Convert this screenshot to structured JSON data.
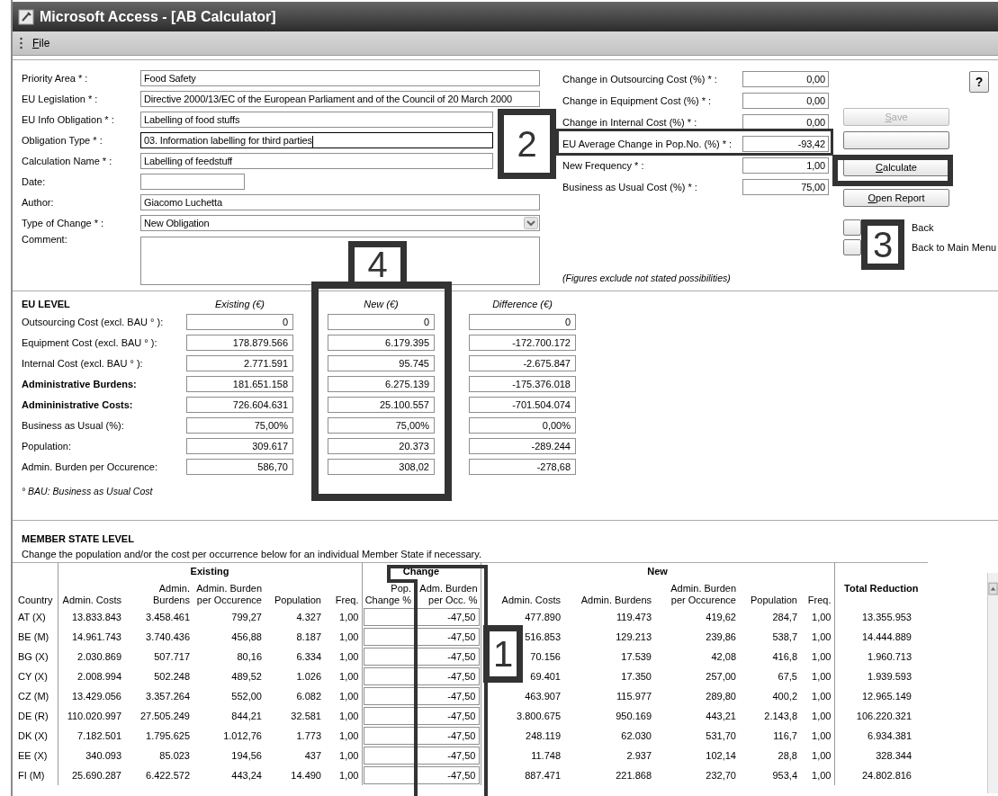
{
  "window": {
    "title": "Microsoft Access - [AB Calculator]"
  },
  "menu": [
    {
      "label": "File"
    }
  ],
  "details": [
    {
      "kind": "text",
      "label": "Priority Area * :",
      "value": "Food Safety",
      "focused": false
    },
    {
      "kind": "text",
      "label": "EU Legislation * :",
      "value": "Directive 2000/13/EC of the European Parliament and of the Council of 20 March 2000",
      "focused": false
    },
    {
      "kind": "text",
      "label": "EU Info Obligation * :",
      "value": "Labelling of food stuffs",
      "focused": false
    },
    {
      "kind": "text",
      "label": "Obligation Type * :",
      "value": "03. Information labelling for third parties",
      "focused": true
    },
    {
      "kind": "text",
      "label": "Calculation Name * :",
      "value": "Labelling of feedstuff",
      "focused": false
    },
    {
      "kind": "date",
      "label": "Date:"
    },
    {
      "kind": "text",
      "label": "Author:",
      "value": "Giacomo Luchetta",
      "focused": false
    },
    {
      "kind": "dropdown",
      "label": "Type of Change * :",
      "value": "New Obligation"
    },
    {
      "kind": "memo",
      "label": "Comment:"
    }
  ],
  "parameters": [
    {
      "label": "Change in Outsourcing Cost (%) * :",
      "value": "0,00"
    },
    {
      "label": "Change in Equipment Cost (%) * :",
      "value": "0,00"
    },
    {
      "label": "Change in Internal Cost (%) * :",
      "value": "0,00"
    },
    {
      "label": "EU Average Change in Pop.No. (%) * :",
      "value": "-93,42"
    },
    {
      "label": "New Frequency * :",
      "value": "1,00"
    },
    {
      "label": "Business as Usual Cost (%) * :",
      "value": "75,00"
    }
  ],
  "help_button": {
    "label": "?"
  },
  "actions": [
    {
      "kind": "button",
      "label": "Save",
      "disabled": true
    },
    {
      "kind": "button",
      "disabled": false
    },
    {
      "kind": "button",
      "label": "Calculate",
      "disabled": false
    },
    {
      "kind": "button",
      "label": "Open Report",
      "disabled": false
    },
    {
      "kind": "square",
      "label": "Back"
    },
    {
      "kind": "square",
      "label": "Back to Main Menu"
    }
  ],
  "note": "(Figures exclude not stated possibilities)",
  "eu_level": {
    "title": "EU LEVEL",
    "columns": [
      "Existing (€)",
      "New (€)",
      "Difference (€)"
    ],
    "rows": [
      {
        "label": "Outsourcing Cost (excl. BAU ° ):",
        "bold": false,
        "values": [
          "0",
          "0",
          "0"
        ]
      },
      {
        "label": "Equipment Cost (excl. BAU ° ):",
        "bold": false,
        "values": [
          "178.879.566",
          "6.179.395",
          "-172.700.172"
        ]
      },
      {
        "label": "Internal Cost (excl. BAU ° ):",
        "bold": false,
        "values": [
          "2.771.591",
          "95.745",
          "-2.675.847"
        ]
      },
      {
        "label": "Administrative Burdens:",
        "bold": true,
        "values": [
          "181.651.158",
          "6.275.139",
          "-175.376.018"
        ]
      },
      {
        "label": "Admininistrative Costs:",
        "bold": true,
        "values": [
          "726.604.631",
          "25.100.557",
          "-701.504.074"
        ]
      },
      {
        "label": "Business as Usual (%):",
        "bold": false,
        "values": [
          "75,00%",
          "75,00%",
          "0,00%"
        ]
      },
      {
        "label": "Population:",
        "bold": false,
        "values": [
          "309.617",
          "20.373",
          "-289.244"
        ]
      },
      {
        "label": "Admin. Burden per Occurence:",
        "bold": false,
        "values": [
          "586,70",
          "308,02",
          "-278,68"
        ]
      }
    ],
    "footnote": "° BAU: Business as Usual Cost"
  },
  "member_states": {
    "title": "MEMBER STATE LEVEL",
    "hint": "Change the population and/or the cost per occurrence below for an individual Member State if necessary.",
    "groups": [
      "Existing",
      "Change",
      "New"
    ],
    "columns": [
      "Country",
      "Admin. Costs",
      "Admin. Burdens",
      "Admin. Burden per Occurence",
      "Population",
      "Freq.",
      "Pop. Change %",
      "Adm. Burden per Occ.  %",
      "Admin. Costs",
      "Admin. Burdens",
      "Admin. Burden per Occurence",
      "Population",
      "Freq.",
      "Total Reduction"
    ],
    "rows": [
      {
        "country": "AT (X)",
        "existing": [
          "13.833.843",
          "3.458.461",
          "799,27",
          "4.327",
          "1,00"
        ],
        "burden_change": "-47,50",
        "new": [
          "477.890",
          "119.473",
          "419,62",
          "284,7",
          "1,00"
        ],
        "total": "13.355.953"
      },
      {
        "country": "BE (M)",
        "existing": [
          "14.961.743",
          "3.740.436",
          "456,88",
          "8.187",
          "1,00"
        ],
        "burden_change": "-47,50",
        "new": [
          "516.853",
          "129.213",
          "239,86",
          "538,7",
          "1,00"
        ],
        "total": "14.444.889"
      },
      {
        "country": "BG (X)",
        "existing": [
          "2.030.869",
          "507.717",
          "80,16",
          "6.334",
          "1,00"
        ],
        "burden_change": "-47,50",
        "new": [
          "70.156",
          "17.539",
          "42,08",
          "416,8",
          "1,00"
        ],
        "total": "1.960.713"
      },
      {
        "country": "CY (X)",
        "existing": [
          "2.008.994",
          "502.248",
          "489,52",
          "1.026",
          "1,00"
        ],
        "burden_change": "-47,50",
        "new": [
          "69.401",
          "17.350",
          "257,00",
          "67,5",
          "1,00"
        ],
        "total": "1.939.593"
      },
      {
        "country": "CZ (M)",
        "existing": [
          "13.429.056",
          "3.357.264",
          "552,00",
          "6.082",
          "1,00"
        ],
        "burden_change": "-47,50",
        "new": [
          "463.907",
          "115.977",
          "289,80",
          "400,2",
          "1,00"
        ],
        "total": "12.965.149"
      },
      {
        "country": "DE (R)",
        "existing": [
          "110.020.997",
          "27.505.249",
          "844,21",
          "32.581",
          "1,00"
        ],
        "burden_change": "-47,50",
        "new": [
          "3.800.675",
          "950.169",
          "443,21",
          "2.143,8",
          "1,00"
        ],
        "total": "106.220.321"
      },
      {
        "country": "DK (X)",
        "existing": [
          "7.182.501",
          "1.795.625",
          "1.012,76",
          "1.773",
          "1,00"
        ],
        "burden_change": "-47,50",
        "new": [
          "248.119",
          "62.030",
          "531,70",
          "116,7",
          "1,00"
        ],
        "total": "6.934.381"
      },
      {
        "country": "EE (X)",
        "existing": [
          "340.093",
          "85.023",
          "194,56",
          "437",
          "1,00"
        ],
        "burden_change": "-47,50",
        "new": [
          "11.748",
          "2.937",
          "102,14",
          "28,8",
          "1,00"
        ],
        "total": "328.344"
      },
      {
        "country": "FI (M)",
        "existing": [
          "25.690.287",
          "6.422.572",
          "443,24",
          "14.490",
          "1,00"
        ],
        "burden_change": "-47,50",
        "new": [
          "887.471",
          "221.868",
          "232,70",
          "953,4",
          "1,00"
        ],
        "total": "24.802.816"
      }
    ]
  },
  "callouts": [
    {
      "number": "2"
    },
    {
      "number": "3"
    },
    {
      "number": "4"
    },
    {
      "number": "1"
    }
  ]
}
